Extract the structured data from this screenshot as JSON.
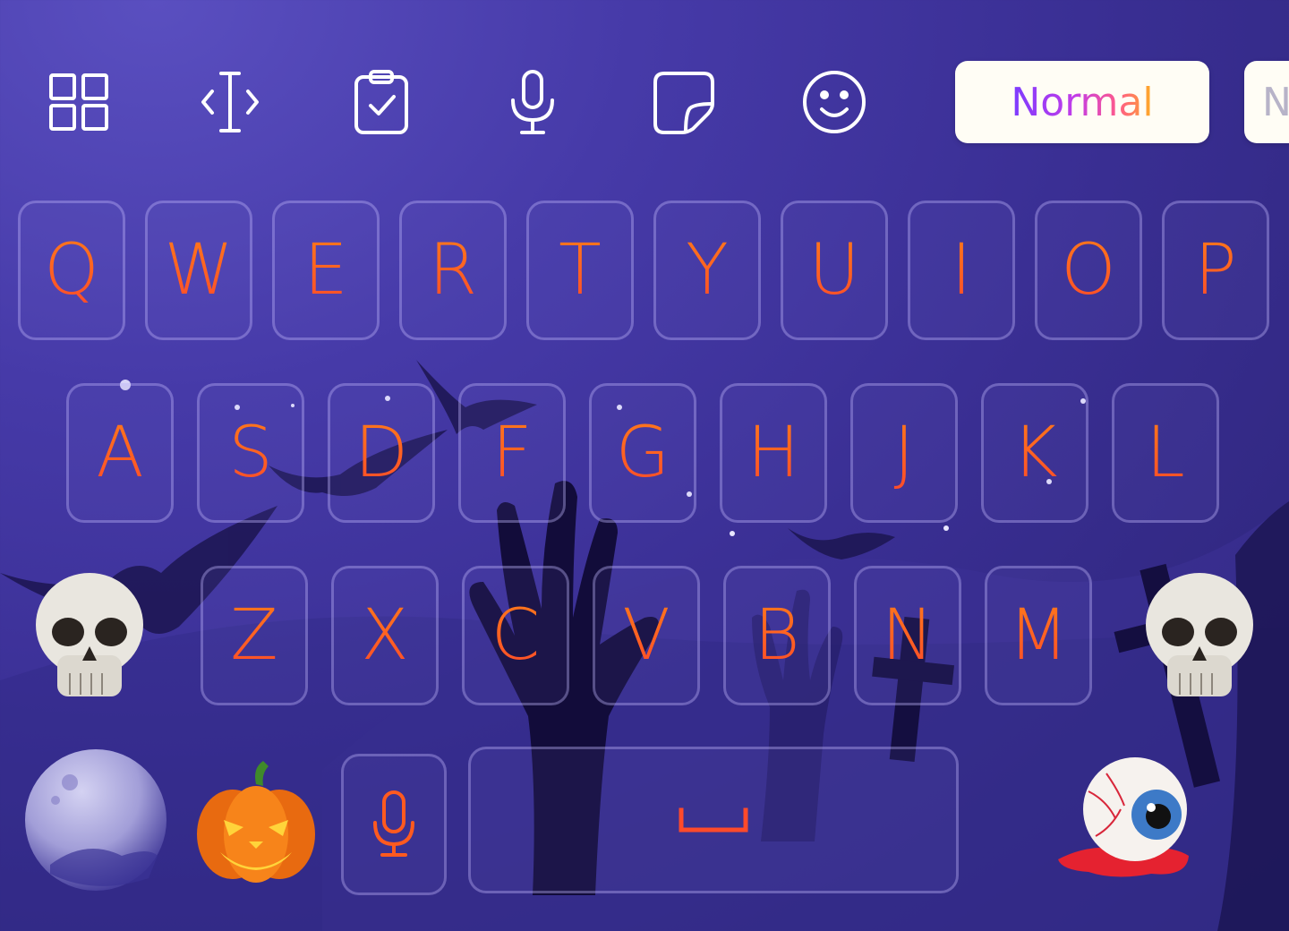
{
  "toolbar": {
    "icons": [
      "grid-icon",
      "cursor-move-icon",
      "clipboard-icon",
      "microphone-icon",
      "sticker-icon",
      "emoji-smile-icon"
    ],
    "mode_active_label": "Normal",
    "mode_partial_label": "N"
  },
  "keyboard": {
    "row1": [
      "Q",
      "W",
      "E",
      "R",
      "T",
      "Y",
      "U",
      "I",
      "O",
      "P"
    ],
    "row2": [
      "A",
      "S",
      "D",
      "F",
      "G",
      "H",
      "J",
      "K",
      "L"
    ],
    "row3": [
      "Z",
      "X",
      "C",
      "V",
      "B",
      "N",
      "M"
    ],
    "bottom": {
      "mic_key_icon": "microphone-icon",
      "space_key_icon": "space-bar-icon"
    }
  },
  "decorations": [
    "moon",
    "pumpkin",
    "skull",
    "skull",
    "eyeball",
    "bats",
    "zombie-hand",
    "grave-cross"
  ],
  "colors": {
    "key_text": "#ff5a1f",
    "background": "#3a2f94",
    "icon_stroke": "#ffffff"
  }
}
